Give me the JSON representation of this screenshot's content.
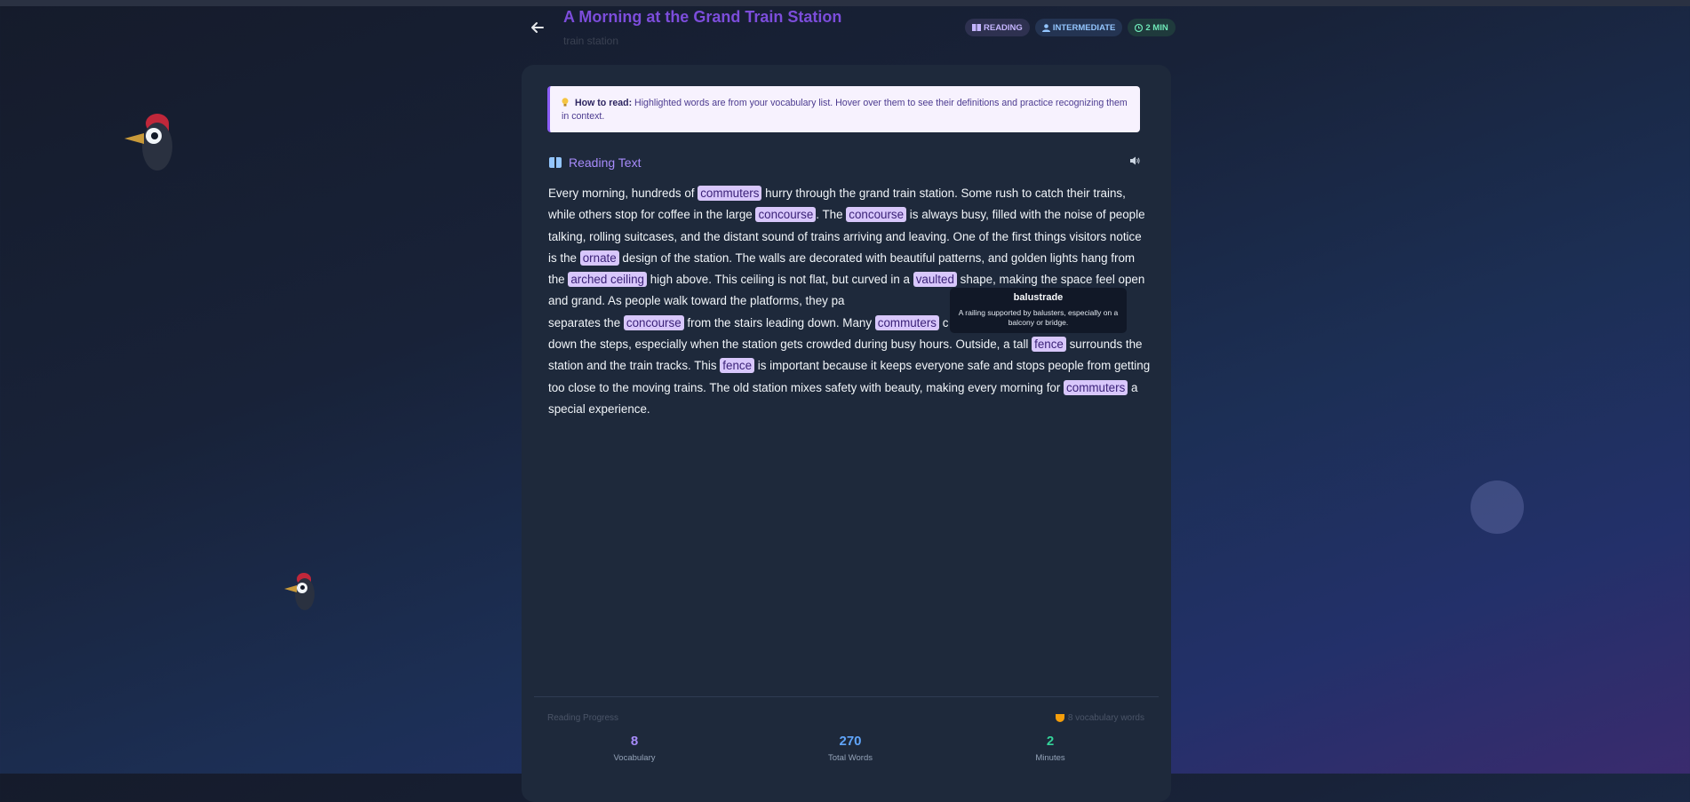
{
  "header": {
    "title": "A Morning at the Grand Train Station",
    "subtitle": "train station",
    "badges": {
      "reading": "READING",
      "level": "INTERMEDIATE",
      "time": "2 MIN"
    }
  },
  "howto": {
    "label": "How to read:",
    "text": " Highlighted words are from your vocabulary list. Hover over them to see their definitions and practice recognizing them in context."
  },
  "section": {
    "title": "Reading Text"
  },
  "passage": {
    "t0": "Every morning, hundreds of ",
    "v0": "commuters",
    "t1": " hurry through the grand train station. Some rush to catch their trains, while others stop for coffee in the large ",
    "v1": "concourse",
    "t2": ". The ",
    "v2": "concourse",
    "t3": " is always busy, filled with the noise of people talking, rolling suitcases, and the distant sound of trains arriving and leaving. One of the first things visitors notice is the ",
    "v3": "ornate",
    "t4": " design of the station. The walls are decorated with beautiful patterns, and golden lights hang from the ",
    "v4": "arched ceiling",
    "t5": " high above. This ceiling is not flat, but curved in a ",
    "v5": "vaulted",
    "t6": " shape, making the space feel open and grand. As people walk toward the platforms, they pa",
    "t6b": "separates the ",
    "v6": "concourse",
    "t7": " from the stairs leading down. Many ",
    "v7": "commuters",
    "t8": " c",
    "t8b": "down the steps, especially when the station gets crowded during busy hours. Outside, a tall ",
    "v8": "fence",
    "t9": " surrounds the station and the train tracks. This ",
    "v9": "fence",
    "t10": " is important because it keeps everyone safe and stops people from getting too close to the moving trains. The old station mixes safety with beauty, making every morning for ",
    "v10": "commuters",
    "t11": " a special experience."
  },
  "tooltip": {
    "word": "balustrade",
    "definition": "A railing supported by balusters, especially on a balcony or bridge."
  },
  "progress": {
    "label": "Reading Progress",
    "summary": "8 vocabulary words",
    "stats": [
      {
        "value": "8",
        "label": "Vocabulary",
        "color": "#a78bfa"
      },
      {
        "value": "270",
        "label": "Total Words",
        "color": "#60a5fa"
      },
      {
        "value": "2",
        "label": "Minutes",
        "color": "#34d399"
      }
    ]
  },
  "icons": {
    "back": "arrow-left-icon",
    "reading": "book-open-icon",
    "level": "user-icon",
    "time": "clock-icon",
    "tip": "lightbulb-icon",
    "section": "book-icon",
    "audio": "speaker-icon",
    "summary": "trophy-icon"
  },
  "colors": {
    "accent": "#7c4ddb",
    "highlight_bg": "#d8c7fb",
    "highlight_text": "#3b2278",
    "card_bg": "#1e293b"
  }
}
